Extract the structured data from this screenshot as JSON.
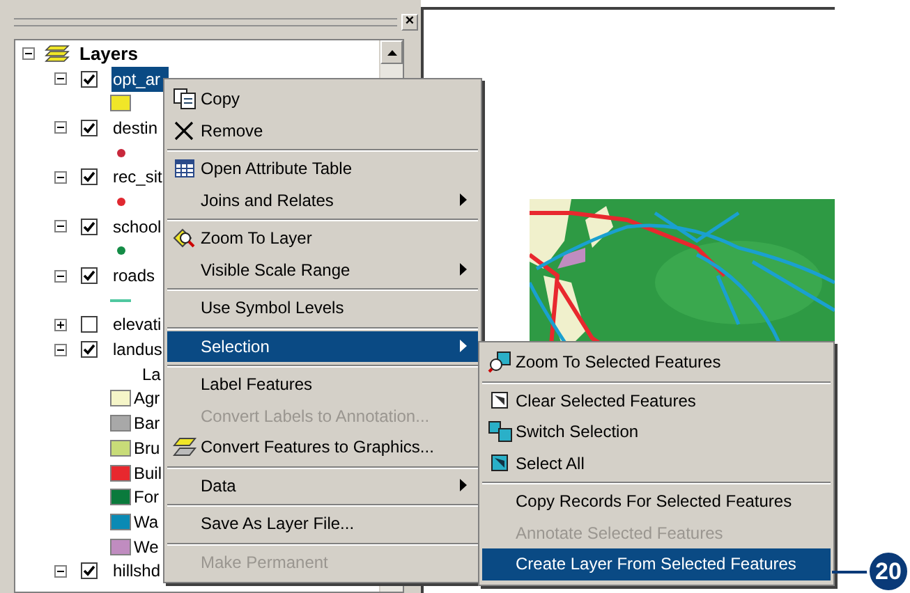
{
  "panel": {
    "close": "×"
  },
  "tree": {
    "label": "Layers",
    "expanded": true,
    "children": [
      {
        "label": "opt_ar",
        "expanded": true,
        "checked": true,
        "selected": true,
        "children": [
          {
            "kind": "swatch",
            "color": "#f0e628"
          }
        ]
      },
      {
        "label": "destin",
        "expanded": true,
        "checked": true,
        "selected": false,
        "children": [
          {
            "kind": "dot",
            "color": "#c8283c"
          }
        ]
      },
      {
        "label": "rec_sit",
        "expanded": true,
        "checked": true,
        "selected": false,
        "children": [
          {
            "kind": "dot",
            "color": "#e02830"
          }
        ]
      },
      {
        "label": "school",
        "expanded": true,
        "checked": true,
        "selected": false,
        "children": [
          {
            "kind": "dot",
            "color": "#148c46"
          }
        ]
      },
      {
        "label": "roads",
        "expanded": true,
        "checked": true,
        "selected": false,
        "children": [
          {
            "kind": "line",
            "color": "#50c8a0"
          }
        ]
      },
      {
        "label": "elevati",
        "expanded": false,
        "checked": false,
        "selected": false
      },
      {
        "label": "landus",
        "expanded": true,
        "checked": true,
        "selected": false,
        "children": [
          {
            "kind": "heading",
            "label": "La"
          },
          {
            "kind": "swatch",
            "color": "#f5f5c8",
            "label": "Agr"
          },
          {
            "kind": "swatch",
            "color": "#a8a8a8",
            "label": "Bar"
          },
          {
            "kind": "swatch",
            "color": "#c8dc78",
            "label": "Bru"
          },
          {
            "kind": "swatch",
            "color": "#e8282e",
            "label": "Buil"
          },
          {
            "kind": "swatch",
            "color": "#0a7a3c",
            "label": "For"
          },
          {
            "kind": "swatch",
            "color": "#0a8ab4",
            "label": "Wa"
          },
          {
            "kind": "swatch",
            "color": "#c08cc0",
            "label": "We"
          }
        ]
      },
      {
        "label": "hillshd",
        "expanded": true,
        "checked": true,
        "selected": false
      }
    ]
  },
  "context_menu": {
    "groups": [
      [
        {
          "label": "Copy",
          "disabled": false,
          "selected": false,
          "submenu": false
        },
        {
          "label": "Remove",
          "disabled": false,
          "selected": false,
          "submenu": false
        }
      ],
      [
        {
          "label": "Open Attribute Table",
          "disabled": false,
          "selected": false,
          "submenu": false
        },
        {
          "label": "Joins and Relates",
          "disabled": false,
          "selected": false,
          "submenu": true
        }
      ],
      [
        {
          "label": "Zoom To Layer",
          "disabled": false,
          "selected": false,
          "submenu": false
        },
        {
          "label": "Visible Scale Range",
          "disabled": false,
          "selected": false,
          "submenu": true
        }
      ],
      [
        {
          "label": "Use Symbol Levels",
          "disabled": false,
          "selected": false,
          "submenu": false
        }
      ],
      [
        {
          "label": "Selection",
          "disabled": false,
          "selected": true,
          "submenu": true
        }
      ],
      [
        {
          "label": "Label Features",
          "disabled": false,
          "selected": false,
          "submenu": false
        },
        {
          "label": "Convert Labels to Annotation...",
          "disabled": true,
          "selected": false,
          "submenu": false
        },
        {
          "label": "Convert Features to Graphics...",
          "disabled": false,
          "selected": false,
          "submenu": false
        }
      ],
      [
        {
          "label": "Data",
          "disabled": false,
          "selected": false,
          "submenu": true
        }
      ],
      [
        {
          "label": "Save As Layer File...",
          "disabled": false,
          "selected": false,
          "submenu": false
        }
      ],
      [
        {
          "label": "Make Permanent",
          "disabled": true,
          "selected": false,
          "submenu": false
        }
      ]
    ]
  },
  "submenu": {
    "groups": [
      [
        {
          "label": "Zoom To Selected Features",
          "disabled": false,
          "selected": false
        }
      ],
      [
        {
          "label": "Clear Selected Features",
          "disabled": false,
          "selected": false
        },
        {
          "label": "Switch Selection",
          "disabled": false,
          "selected": false
        },
        {
          "label": "Select All",
          "disabled": false,
          "selected": false
        }
      ],
      [
        {
          "label": "Copy Records For Selected Features",
          "disabled": false,
          "selected": false
        },
        {
          "label": "Annotate Selected Features",
          "disabled": true,
          "selected": false
        },
        {
          "label": "Create Layer From Selected Features",
          "disabled": false,
          "selected": true
        }
      ]
    ]
  },
  "callout": {
    "label": "20"
  }
}
